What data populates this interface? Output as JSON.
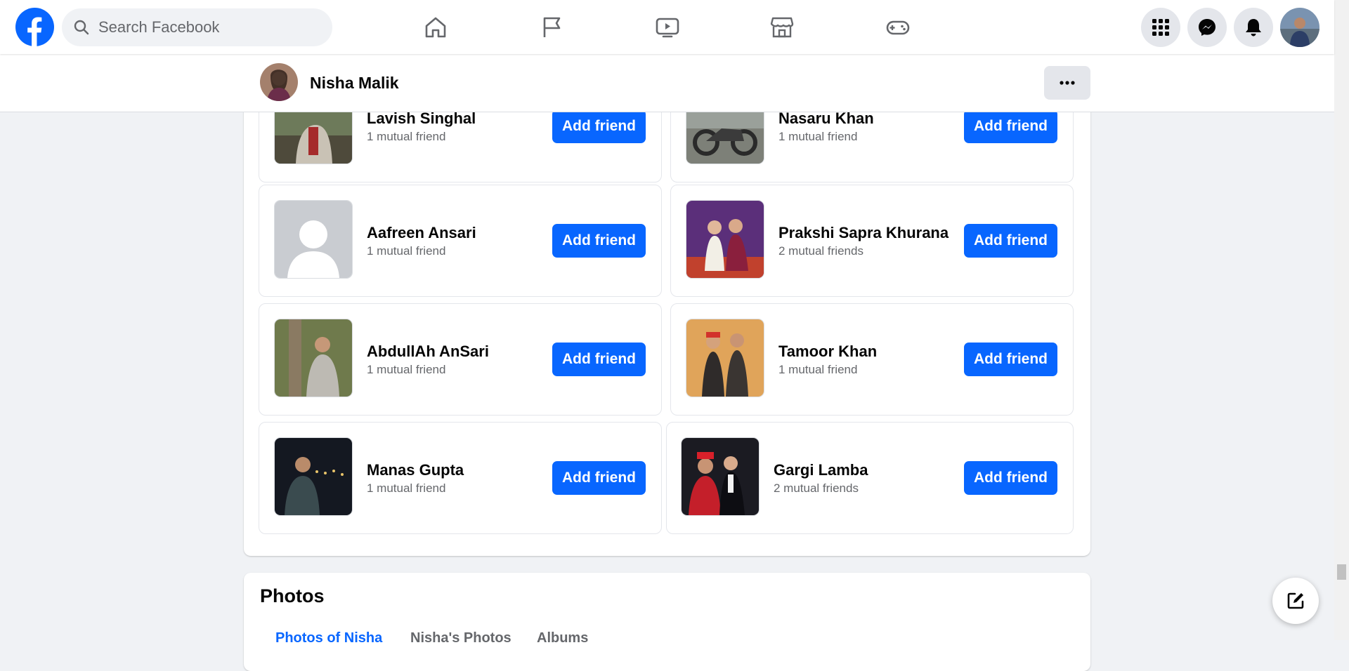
{
  "search": {
    "placeholder": "Search Facebook"
  },
  "nav": {
    "home": "home-icon",
    "pages": "flag-icon",
    "watch": "video-icon",
    "marketplace": "marketplace-icon",
    "gaming": "gaming-icon"
  },
  "header_actions": [
    "menu-grid-icon",
    "messenger-icon",
    "bell-icon",
    "account-avatar"
  ],
  "profile": {
    "name": "Nisha Malik",
    "more": "more-icon"
  },
  "friends": [
    {
      "name": "Lavish Singhal",
      "mutual": "1 mutual friend",
      "button": "Add friend"
    },
    {
      "name": "Nasaru Khan",
      "mutual": "1 mutual friend",
      "button": "Add friend"
    },
    {
      "name": "Aafreen Ansari",
      "mutual": "1 mutual friend",
      "button": "Add friend"
    },
    {
      "name": "Prakshi Sapra Khurana",
      "mutual": "2 mutual friends",
      "button": "Add friend"
    },
    {
      "name": "AbdullAh AnSari",
      "mutual": "1 mutual friend",
      "button": "Add friend"
    },
    {
      "name": "Tamoor Khan",
      "mutual": "1 mutual friend",
      "button": "Add friend"
    },
    {
      "name": "Manas Gupta",
      "mutual": "1 mutual friend",
      "button": "Add friend"
    },
    {
      "name": "Gargi Lamba",
      "mutual": "2 mutual friends",
      "button": "Add friend"
    }
  ],
  "photos": {
    "title": "Photos",
    "tabs": [
      "Photos of Nisha",
      "Nisha's Photos",
      "Albums"
    ]
  },
  "colors": {
    "accent": "#0866ff",
    "page_bg": "#f0f2f5"
  }
}
